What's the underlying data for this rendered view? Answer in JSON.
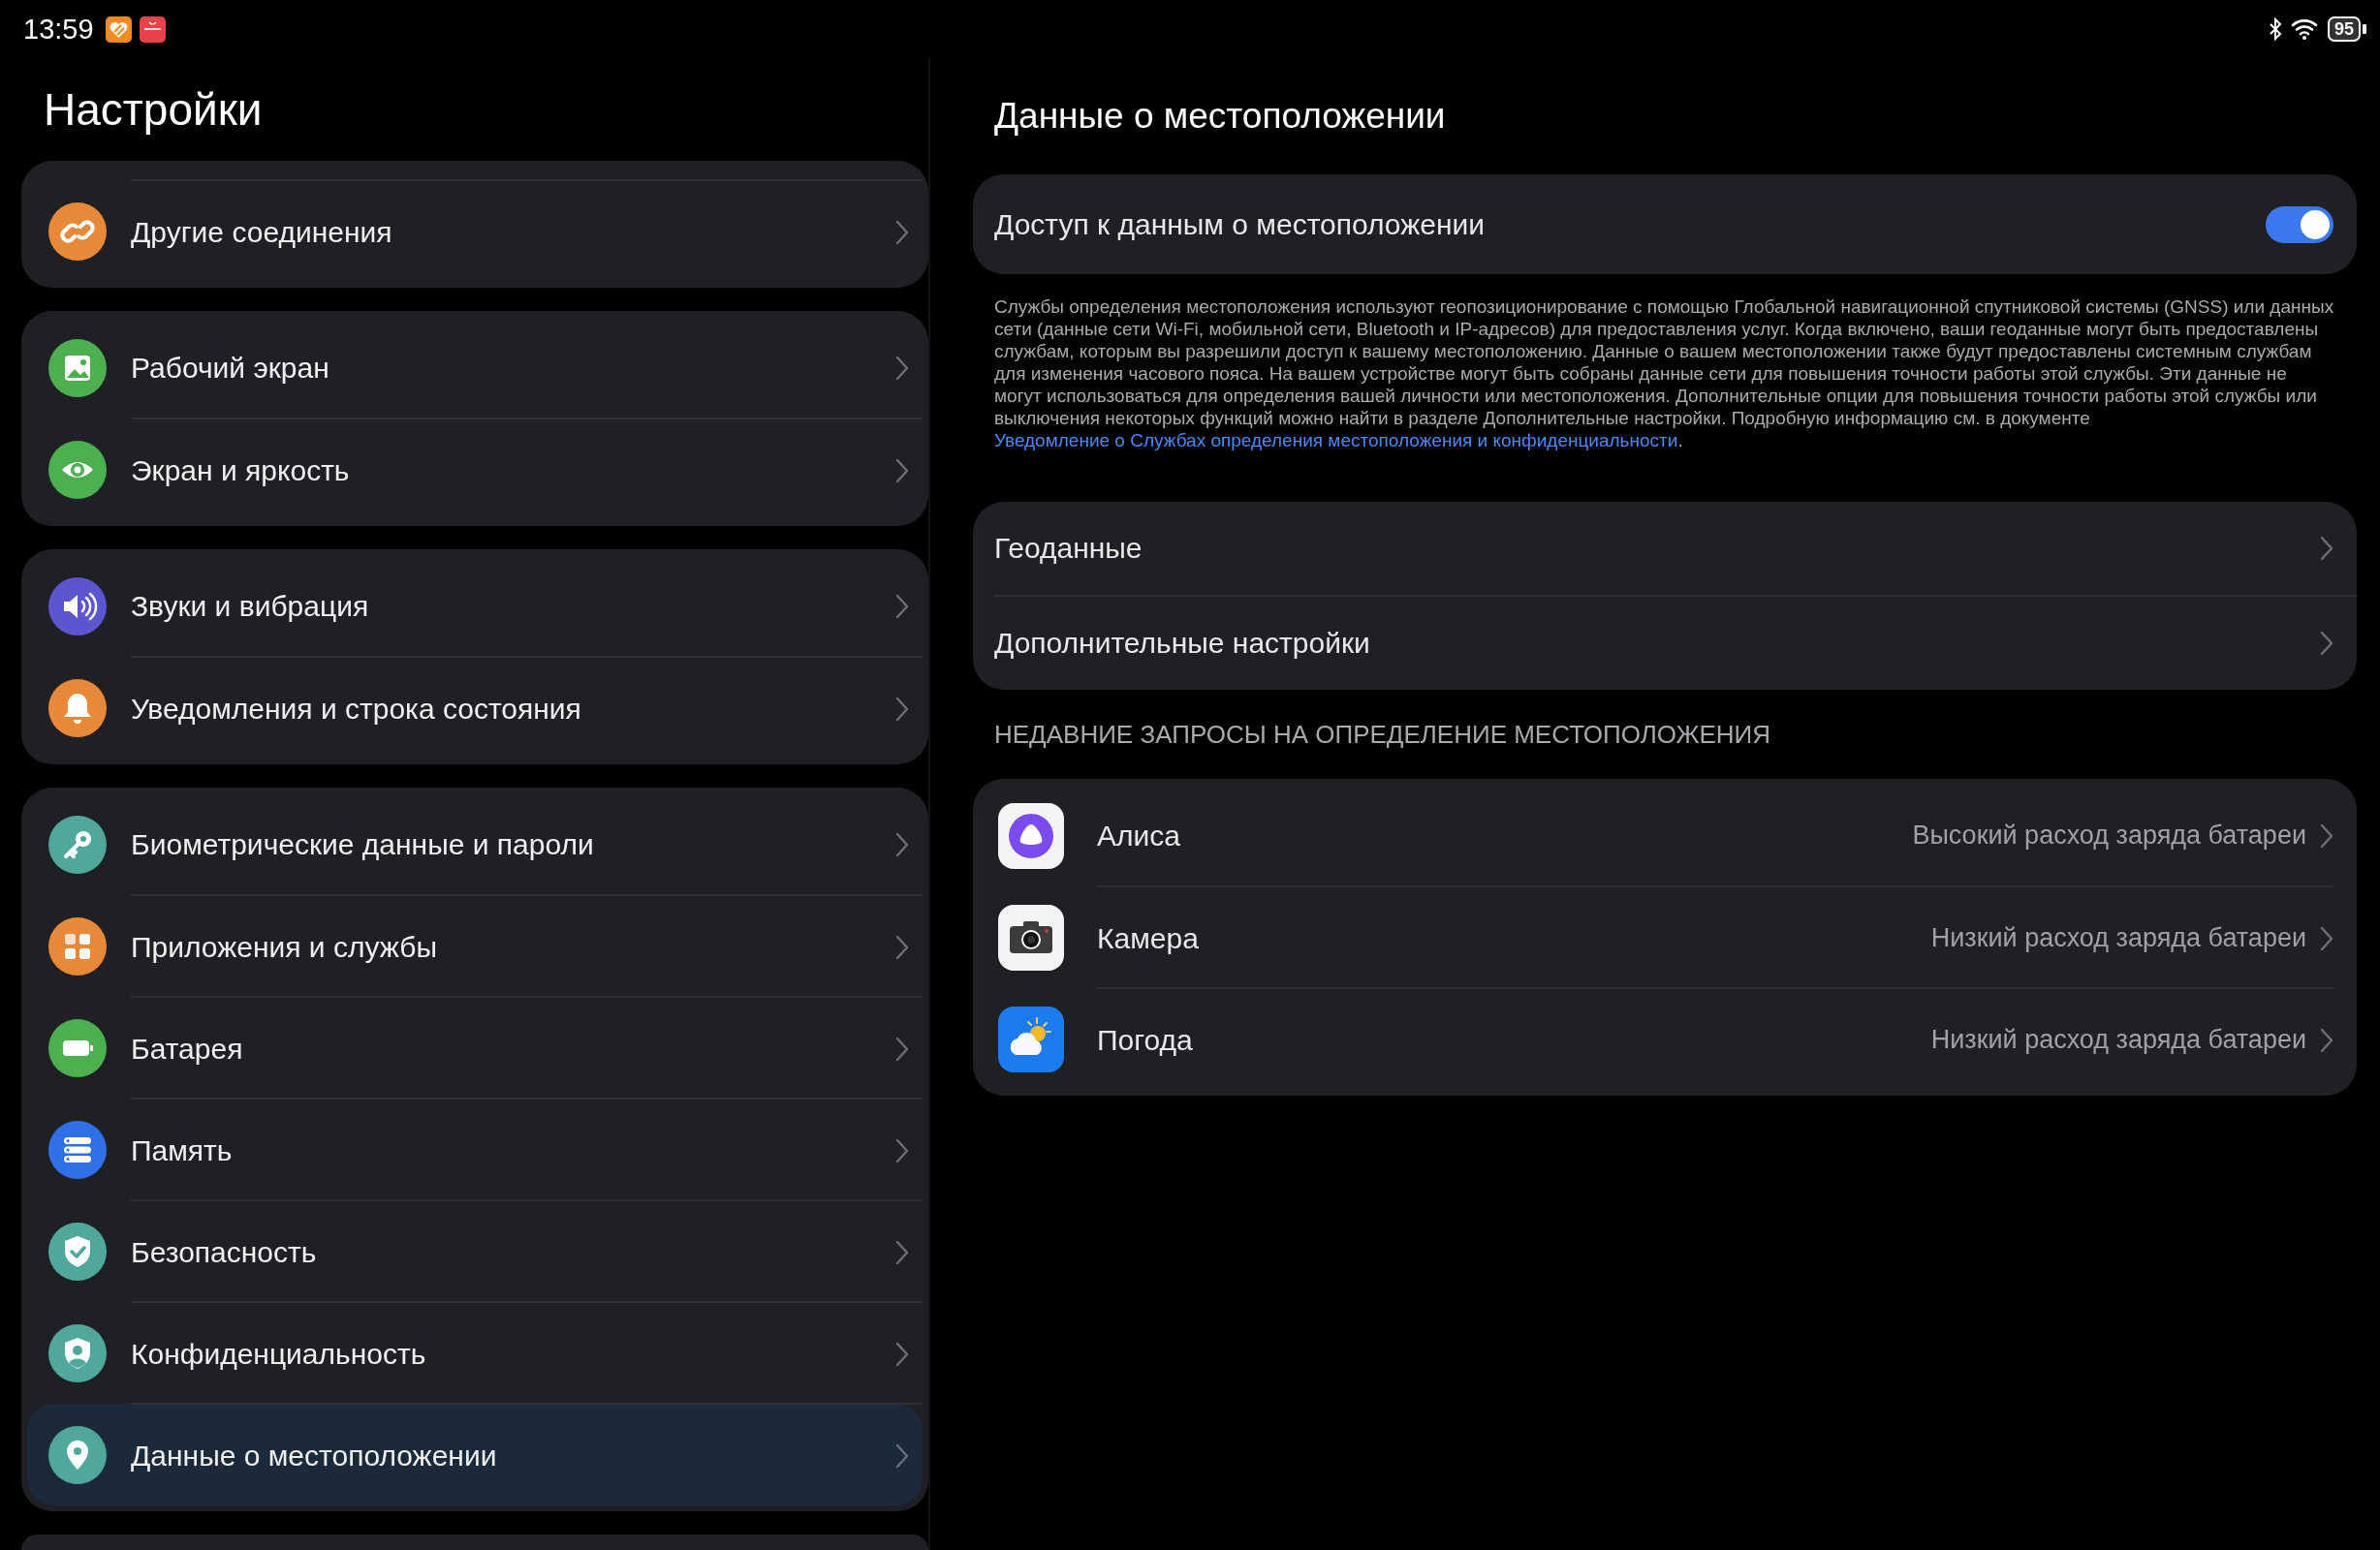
{
  "status_bar": {
    "time": "13:59",
    "battery": "95"
  },
  "sidebar": {
    "title": "Настройки",
    "groups": [
      {
        "items": [
          {
            "label": "Другие соединения",
            "kind": "link",
            "selected": false
          }
        ]
      },
      {
        "items": [
          {
            "label": "Рабочий экран",
            "kind": "picture",
            "selected": false
          },
          {
            "label": "Экран и яркость",
            "kind": "eye",
            "selected": false
          }
        ]
      },
      {
        "items": [
          {
            "label": "Звуки и вибрация",
            "kind": "speaker",
            "selected": false
          },
          {
            "label": "Уведомления и строка состояния",
            "kind": "bell",
            "selected": false
          }
        ]
      },
      {
        "items": [
          {
            "label": "Биометрические данные и пароли",
            "kind": "key",
            "selected": false
          },
          {
            "label": "Приложения и службы",
            "kind": "apps",
            "selected": false
          },
          {
            "label": "Батарея",
            "kind": "battery",
            "selected": false
          },
          {
            "label": "Память",
            "kind": "storage",
            "selected": false
          },
          {
            "label": "Безопасность",
            "kind": "shield",
            "selected": false
          },
          {
            "label": "Конфиденциальность",
            "kind": "privacy",
            "selected": false
          },
          {
            "label": "Данные о местоположении",
            "kind": "location",
            "selected": true
          }
        ]
      }
    ]
  },
  "location_pane": {
    "title": "Данные о местоположении",
    "access": {
      "label": "Доступ к данным о местоположении",
      "on": true
    },
    "description": {
      "text": "Службы определения местоположения используют геопозиционирование с помощью Глобальной навигационной спутниковой системы (GNSS) или данных сети (данные сети Wi-Fi, мобильной сети, Bluetooth и IP-адресов) для предоставления услуг. Когда включено, ваши геоданные могут быть предоставлены службам, которым вы разрешили доступ к вашему местоположению. Данные о вашем местоположении также будут предоставлены системным службам для изменения часового пояса. На вашем устройстве могут быть собраны данные сети для повышения точности работы этой службы. Эти данные не могут использоваться для определения вашей личности или местоположения. Дополнительные опции для повышения точности работы этой службы или выключения некоторых функций можно найти в разделе Дополнительные настройки. Подробную информацию см. в документе",
      "link": "Уведомление о Службах определения местоположения и конфиденциальности",
      "after": "."
    },
    "links": [
      "Геоданные",
      "Дополнительные настройки"
    ],
    "recent_header": "НЕДАВНИЕ ЗАПРОСЫ НА ОПРЕДЕЛЕНИЕ МЕСТОПОЛОЖЕНИЯ",
    "recent": [
      {
        "app": "Алиса",
        "kind": "assistant",
        "usage": "Высокий расход заряда батареи"
      },
      {
        "app": "Камера",
        "kind": "camera",
        "usage": "Низкий расход заряда батареи"
      },
      {
        "app": "Погода",
        "kind": "weather",
        "usage": "Низкий расход заряда батареи"
      }
    ]
  }
}
